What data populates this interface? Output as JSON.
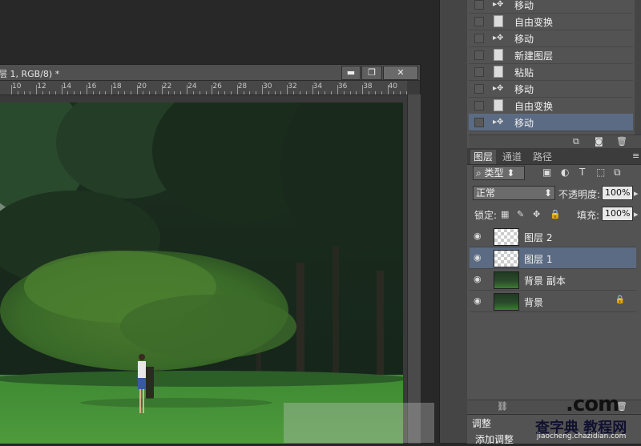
{
  "document": {
    "title": "层 1, RGB/8) *",
    "ruler_ticks": [
      "10",
      "12",
      "14",
      "16",
      "18",
      "20",
      "22",
      "24",
      "26",
      "28",
      "30",
      "32",
      "34",
      "36",
      "38",
      "40"
    ],
    "min_label": "▬",
    "max_label": "❐",
    "close_label": "✕"
  },
  "history": {
    "items": [
      {
        "label": "移动",
        "icon": "move-arrow-icon"
      },
      {
        "label": "自由变换",
        "icon": "document-icon"
      },
      {
        "label": "移动",
        "icon": "move-arrow-icon"
      },
      {
        "label": "新建图层",
        "icon": "document-icon"
      },
      {
        "label": "粘贴",
        "icon": "document-icon"
      },
      {
        "label": "移动",
        "icon": "move-arrow-icon"
      },
      {
        "label": "自由变换",
        "icon": "document-icon"
      },
      {
        "label": "移动",
        "icon": "move-arrow-icon"
      }
    ]
  },
  "layers_panel": {
    "tabs": [
      "图层",
      "通道",
      "路径"
    ],
    "filter_kind": "类型",
    "blend_mode": "正常",
    "opacity_label": "不透明度:",
    "opacity_value": "100%",
    "lock_label": "锁定:",
    "fill_label": "填充:",
    "fill_value": "100%",
    "layers": [
      {
        "name": "图层 2",
        "thumb": "transparent"
      },
      {
        "name": "图层 1",
        "thumb": "transparent"
      },
      {
        "name": "背景 副本",
        "thumb": "photo"
      },
      {
        "name": "背景",
        "thumb": "photo"
      }
    ]
  },
  "adjustments": {
    "tab": "调整",
    "add_label": "添加调整"
  },
  "watermark": {
    "line1": ".com",
    "line2": "查字典 教程网",
    "line3": "jiaocheng.chazidian.com"
  },
  "colors": {
    "selection": "#5b6b83",
    "panel_bg": "#535353",
    "workspace_bg": "#282828"
  }
}
